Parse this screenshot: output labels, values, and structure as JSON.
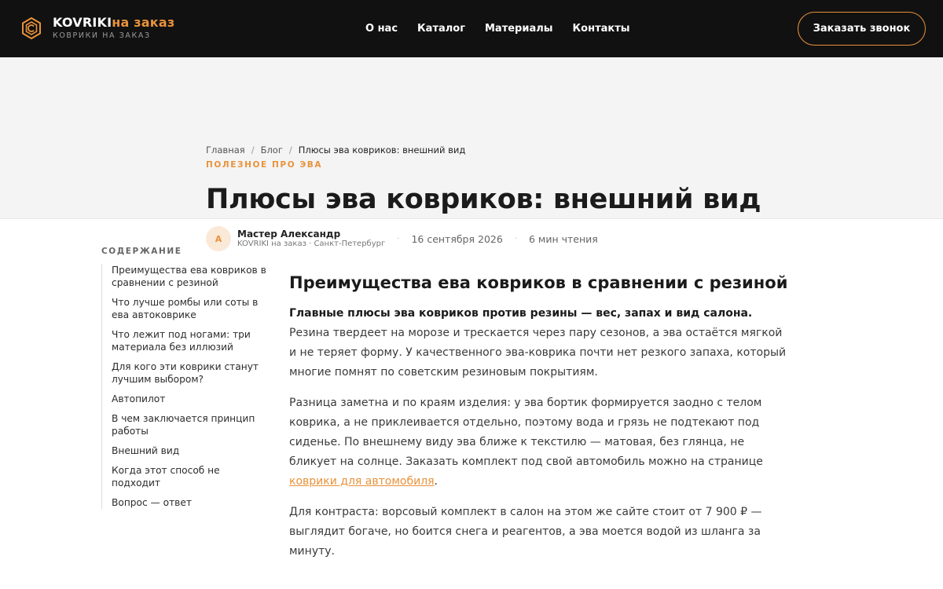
{
  "header": {
    "logo_brand": "KOVRIKI",
    "logo_accent": "на заказ",
    "logo_sub": "КОВРИКИ НА ЗАКАЗ",
    "nav": [
      "О нас",
      "Каталог",
      "Материалы",
      "Контакты"
    ],
    "cta": "Заказать звонок"
  },
  "breadcrumbs": {
    "items": [
      "Главная",
      "Блог"
    ],
    "current": "Плюсы эва ковриков: внешний вид",
    "separator": "/"
  },
  "article_header": {
    "category": "ПОЛЕЗНОЕ ПРО ЭВА",
    "title": "Плюсы эва ковриков: внешний вид",
    "author_initial": "А",
    "author_name": "Мастер Александр",
    "author_org": "KOVRIKI на заказ · Санкт-Петербург",
    "date": "16 сентября 2026",
    "read_time": "6 мин чтения"
  },
  "toc": {
    "label": "СОДЕРЖАНИЕ",
    "items": [
      "Преимущества ева ковриков в сравнении с резиной",
      "Что лучше ромбы или соты в ева автоковрике",
      "Что лежит под ногами: три материала без иллюзий",
      "Для кого эти коврики станут лучшим выбором?",
      "Автопилот",
      "В чем заключается принцип работы",
      "Внешний вид",
      "Когда этот способ не подходит",
      "Вопрос — ответ"
    ]
  },
  "article": {
    "heading": "Преимущества ева ковриков в сравнении с резиной",
    "p1_bold": "Главные плюсы эва ковриков против резины — вес, запах и вид салона.",
    "p1_rest": " Резина твердеет на морозе и трескается через пару сезонов, а эва остаётся мягкой и не теряет форму. У качественного эва-коврика почти нет резкого запаха, который многие помнят по советским резиновым покрытиям.",
    "p2_text": "Разница заметна и по краям изделия: у эва бортик формируется заодно с телом коврика, а не приклеивается отдельно, поэтому вода и грязь не подтекают под сиденье. По внешнему виду эва ближе к текстилю — матовая, без глянца, не бликует на солнце. Заказать комплект под свой автомобиль можно на странице ",
    "p2_link": "коврики для автомобиля",
    "p2_end": ".",
    "p3": "Для контраста: ворсовый комплект в салон на этом же сайте стоит от 7 900 ₽ — выглядит богаче, но боится снега и реагентов, а эва моется водой из шланга за минуту."
  },
  "colors": {
    "accent": "#e8923a",
    "header_bg": "#111111",
    "hero_bg": "#f4f4f5"
  }
}
